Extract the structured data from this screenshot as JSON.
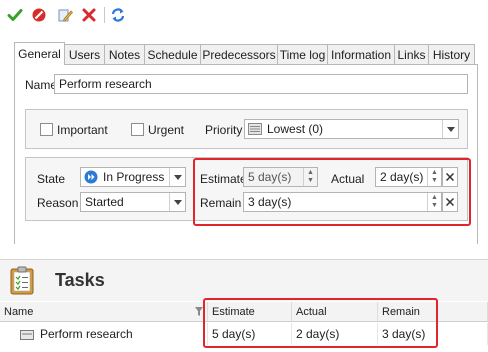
{
  "toolbar": {
    "buttons": [
      {
        "icon": "checkmark-icon",
        "color": "#3aa02a"
      },
      {
        "icon": "cancel-circle-icon",
        "color": "#d92b2b"
      },
      {
        "icon": "edit-pencil-icon",
        "color": "#4a7fc8"
      },
      {
        "icon": "delete-x-icon",
        "color": "#d92b2b"
      },
      {
        "icon": "refresh-icon",
        "color": "#2b7bd6"
      }
    ]
  },
  "tabs": [
    "General",
    "Users",
    "Notes",
    "Schedule",
    "Predecessors",
    "Time log",
    "Information",
    "Links",
    "History"
  ],
  "form": {
    "name_label": "Name",
    "name_value": "Perform research",
    "important_label": "Important",
    "urgent_label": "Urgent",
    "priority_label": "Priority",
    "priority_value": "Lowest (0)",
    "state_label": "State",
    "state_value": "In Progress",
    "reason_label": "Reason",
    "reason_value": "Started",
    "estimate_label": "Estimate",
    "estimate_value": "5 day(s)",
    "actual_label": "Actual",
    "actual_value": "2 day(s)",
    "remain_label": "Remain",
    "remain_value": "3 day(s)"
  },
  "tasks": {
    "title": "Tasks",
    "columns": [
      "Name",
      "Estimate",
      "Actual",
      "Remain"
    ],
    "rows": [
      {
        "name": "Perform research",
        "estimate": "5 day(s)",
        "actual": "2 day(s)",
        "remain": "3 day(s)"
      }
    ]
  },
  "colors": {
    "highlight": "#e0262a",
    "accent": "#2b7bd6"
  }
}
